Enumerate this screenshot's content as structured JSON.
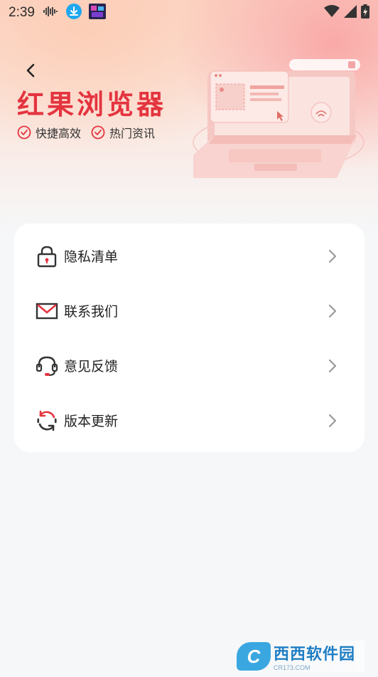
{
  "status_bar": {
    "time": "2:39"
  },
  "header": {
    "title": "红果浏览器",
    "features": [
      "快捷高效",
      "热门资讯"
    ]
  },
  "menu": {
    "items": [
      {
        "label": "隐私清单",
        "icon": "lock-icon"
      },
      {
        "label": "联系我们",
        "icon": "mail-icon"
      },
      {
        "label": "意见反馈",
        "icon": "headset-icon"
      },
      {
        "label": "版本更新",
        "icon": "refresh-icon"
      }
    ]
  },
  "watermark": {
    "logo_letter": "C",
    "brand": "西西软件园",
    "url": "CR173.COM"
  },
  "colors": {
    "accent": "#e4343f",
    "background": "#f6f7f9",
    "card": "#ffffff"
  }
}
